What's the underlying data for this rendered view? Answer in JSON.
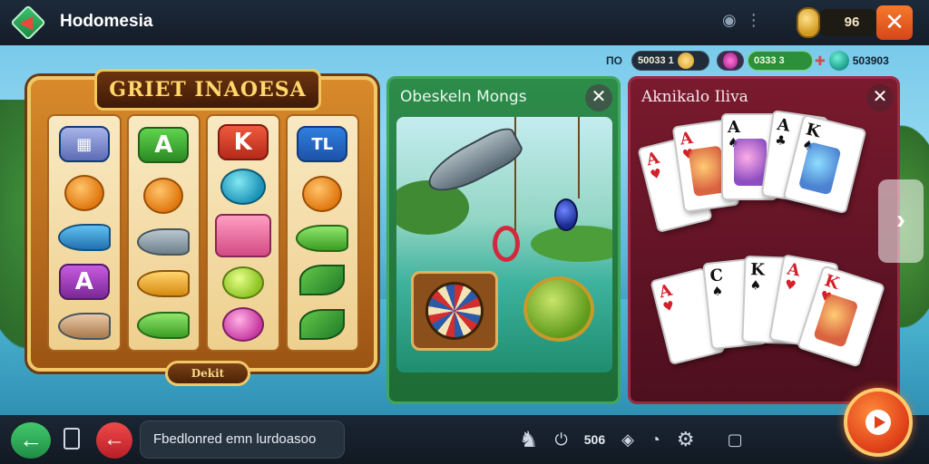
{
  "header": {
    "title": "Hodomesia",
    "coin_count": "96",
    "close_label": "✕"
  },
  "status": {
    "label": "ПО",
    "pill_1": "50033 1",
    "pill_2": "0333 3",
    "pill_3": "503903"
  },
  "slot": {
    "title": "GRIET INAOESA",
    "badge": "Dekit",
    "reel_2_top": "A",
    "reel_3_top": "K",
    "reel_4_top": "TL"
  },
  "fishing": {
    "title": "Obeskeln Mongs",
    "close_label": "✕"
  },
  "cards": {
    "title": "Aknikalo Iliva",
    "close_label": "✕",
    "top_row": [
      {
        "rank": "A",
        "suit": "♥",
        "color": "red"
      },
      {
        "rank": "A",
        "suit": "♠",
        "color": "black"
      },
      {
        "rank": "A",
        "suit": "♣",
        "color": "black"
      },
      {
        "rank": "K",
        "suit": "♠",
        "color": "black"
      }
    ],
    "bottom_row": [
      {
        "rank": "A",
        "suit": "♥",
        "color": "red"
      },
      {
        "rank": "C",
        "suit": "♠",
        "color": "black"
      },
      {
        "rank": "K",
        "suit": "♠",
        "color": "black"
      },
      {
        "rank": "A",
        "suit": "♥",
        "color": "red"
      },
      {
        "rank": "K",
        "suit": "♥",
        "color": "red"
      }
    ]
  },
  "footer": {
    "search_text": "Fbedlonred emn lurdoasoo",
    "count": "506"
  },
  "colors": {
    "topbar": "#1d2a3a",
    "slot_frame": "#f0c86a",
    "fishing_panel": "#2d8c4a",
    "card_panel": "#7a1a2e",
    "accent_orange": "#f57a2c"
  }
}
